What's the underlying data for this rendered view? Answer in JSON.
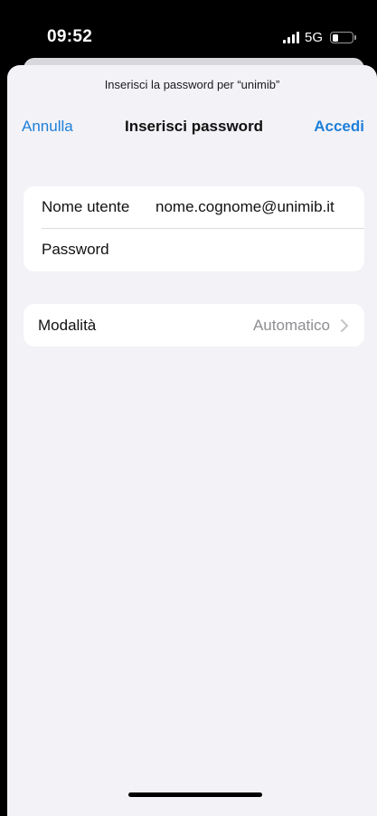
{
  "status_bar": {
    "time": "09:52",
    "network": "5G",
    "icons": [
      "signal-icon",
      "battery-icon"
    ]
  },
  "sheet": {
    "prompt": "Inserisci la password per “unimib”",
    "nav": {
      "cancel_label": "Annulla",
      "title": "Inserisci password",
      "login_label": "Accedi"
    },
    "credentials": {
      "username_label": "Nome utente",
      "username_value": "nome.cognome@unimib.it",
      "password_label": "Password",
      "password_value": ""
    },
    "mode": {
      "label": "Modalità",
      "value": "Automatico",
      "icon": "chevron-right-icon"
    }
  },
  "colors": {
    "accent": "#1e7fd8",
    "background": "#f2f2f7",
    "secondary_text": "#8e8e93"
  }
}
